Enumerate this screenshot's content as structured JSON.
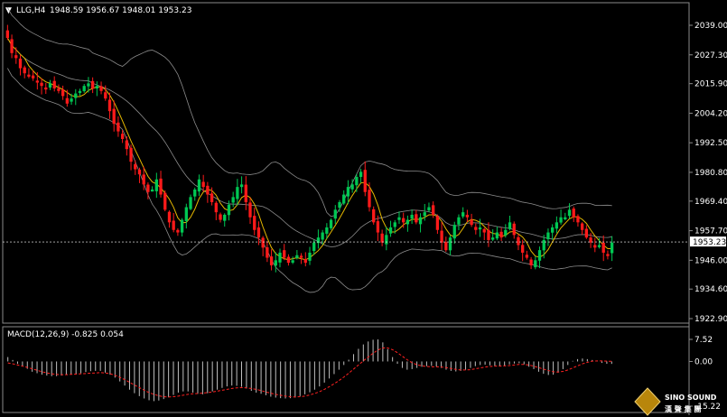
{
  "chart_data": [
    {
      "type": "candlestick",
      "symbol": "LLG,H4",
      "header_values": "1948.59 1956.67 1948.01 1953.23",
      "current_price_label": "1953.23",
      "y_ticks": [
        "2039.00",
        "2027.30",
        "2015.90",
        "2004.20",
        "1992.50",
        "1980.80",
        "1969.40",
        "1957.70",
        "1946.00",
        "1934.60",
        "1922.90"
      ],
      "ylim": [
        1922.9,
        2039.0
      ],
      "overlays": [
        "Bollinger Bands",
        "Moving Average"
      ],
      "colors": {
        "up": "#00c853",
        "down": "#ff1a1a",
        "ma": "#e6b800",
        "bands": "#8c8c8c",
        "bid_line": "#ffffff"
      },
      "close": [
        2034,
        2028,
        2026,
        2022,
        2020,
        2019,
        2018,
        2017,
        2015,
        2014,
        2016,
        2014,
        2013,
        2011,
        2008,
        2010,
        2012,
        2013,
        2015,
        2016,
        2014,
        2015,
        2013,
        2010,
        2005,
        2000,
        1997,
        1994,
        1990,
        1985,
        1982,
        1980,
        1976,
        1973,
        1974,
        1978,
        1972,
        1966,
        1961,
        1958,
        1957,
        1962,
        1967,
        1971,
        1974,
        1978,
        1975,
        1972,
        1969,
        1965,
        1962,
        1964,
        1968,
        1971,
        1975,
        1976,
        1969,
        1963,
        1958,
        1955,
        1951,
        1947,
        1944,
        1946,
        1949,
        1947,
        1945,
        1946,
        1948,
        1947,
        1945,
        1949,
        1953,
        1955,
        1957,
        1959,
        1962,
        1966,
        1969,
        1972,
        1975,
        1976,
        1979,
        1981,
        1973,
        1967,
        1961,
        1957,
        1953,
        1956,
        1959,
        1961,
        1963,
        1961,
        1962,
        1964,
        1961,
        1963,
        1965,
        1967,
        1964,
        1958,
        1953,
        1950,
        1955,
        1960,
        1963,
        1965,
        1963,
        1960,
        1958,
        1959,
        1957,
        1954,
        1955,
        1957,
        1955,
        1958,
        1961,
        1956,
        1952,
        1949,
        1947,
        1944,
        1946,
        1950,
        1954,
        1957,
        1959,
        1961,
        1963,
        1963,
        1966,
        1963,
        1961,
        1958,
        1955,
        1953,
        1951,
        1952,
        1949,
        1948,
        1953
      ]
    },
    {
      "type": "bar",
      "title": "MACD(12,26,9) -0.825 0.054",
      "y_ticks": [
        "7.52",
        "0.00",
        "-15.22"
      ],
      "ylim": [
        -15.22,
        7.52
      ],
      "colors": {
        "histogram": "#c0c0c0",
        "signal": "#ff2020"
      },
      "histogram": [
        1.5,
        0.5,
        -0.8,
        -1.5,
        -2.5,
        -3.5,
        -4,
        -4.5,
        -4.8,
        -5,
        -5,
        -4.8,
        -4.6,
        -4.4,
        -4.3,
        -4,
        -3.6,
        -3.3,
        -3.2,
        -3.2,
        -3.8,
        -4.5,
        -5.5,
        -6.8,
        -8.2,
        -9.6,
        -10.8,
        -11.8,
        -12.6,
        -13.2,
        -13.5,
        -13.3,
        -12.8,
        -12.2,
        -11.4,
        -10.6,
        -10.2,
        -10.2,
        -10.6,
        -11,
        -11.2,
        -10.8,
        -10.2,
        -9.6,
        -9,
        -8.5,
        -8.2,
        -8.3,
        -8.6,
        -9.2,
        -10,
        -10.6,
        -11,
        -11.5,
        -12,
        -12.3,
        -12.5,
        -12.6,
        -12.5,
        -12.3,
        -11.8,
        -11.2,
        -10.5,
        -9.6,
        -8.5,
        -7.2,
        -5.8,
        -4.3,
        -2.8,
        -1.2,
        0.6,
        2.5,
        4.3,
        5.8,
        6.8,
        7.4,
        7.5,
        6.5,
        4.2,
        1.5,
        -0.8,
        -2.2,
        -2.8,
        -2.6,
        -2.2,
        -1.8,
        -1.6,
        -1.5,
        -1.7,
        -2.2,
        -2.8,
        -3.2,
        -3.4,
        -3.2,
        -2.8,
        -2.2,
        -1.6,
        -1.2,
        -1.1,
        -1.3,
        -1.6,
        -1.7,
        -1.4,
        -1,
        -0.7,
        -0.6,
        -1,
        -1.8,
        -2.6,
        -3.5,
        -4.2,
        -4.6,
        -4.5,
        -3.8,
        -2.6,
        -1.2,
        0.2,
        0.8,
        1,
        0.8,
        0.5,
        0.1,
        -0.5,
        -0.8,
        -0.825
      ],
      "signal": [
        -0.5,
        -0.8,
        -1.2,
        -1.6,
        -2,
        -2.5,
        -3,
        -3.5,
        -3.9,
        -4.2,
        -4.4,
        -4.5,
        -4.5,
        -4.4,
        -4.3,
        -4.2,
        -4.1,
        -4,
        -3.9,
        -3.8,
        -3.9,
        -4.2,
        -4.7,
        -5.4,
        -6.2,
        -7.1,
        -8,
        -8.9,
        -9.8,
        -10.6,
        -11.2,
        -11.7,
        -12,
        -12.1,
        -12,
        -11.8,
        -11.5,
        -11.2,
        -11,
        -10.9,
        -10.8,
        -10.6,
        -10.4,
        -10.1,
        -9.8,
        -9.5,
        -9.2,
        -9,
        -8.9,
        -9,
        -9.2,
        -9.5,
        -9.9,
        -10.4,
        -10.8,
        -11.2,
        -11.5,
        -11.8,
        -12,
        -12.1,
        -12,
        -11.8,
        -11.4,
        -10.9,
        -10.3,
        -9.5,
        -8.6,
        -7.6,
        -6.5,
        -5.3,
        -4,
        -2.6,
        -1.2,
        0.2,
        1.5,
        2.8,
        3.9,
        4.6,
        4.6,
        4,
        3,
        1.8,
        0.6,
        -0.4,
        -1.1,
        -1.5,
        -1.7,
        -1.8,
        -1.8,
        -1.9,
        -2.1,
        -2.4,
        -2.7,
        -2.9,
        -2.9,
        -2.8,
        -2.5,
        -2.2,
        -1.9,
        -1.7,
        -1.6,
        -1.6,
        -1.5,
        -1.4,
        -1.2,
        -1,
        -1,
        -1.2,
        -1.6,
        -2.1,
        -2.6,
        -3.1,
        -3.5,
        -3.6,
        -3.4,
        -2.9,
        -2.2,
        -1.5,
        -0.8,
        -0.3,
        0.1,
        0.2,
        0.2,
        0.1,
        0.054
      ]
    }
  ],
  "watermark": {
    "brand": "SINO SOUND",
    "chinese": "漢 聲 集 團"
  }
}
